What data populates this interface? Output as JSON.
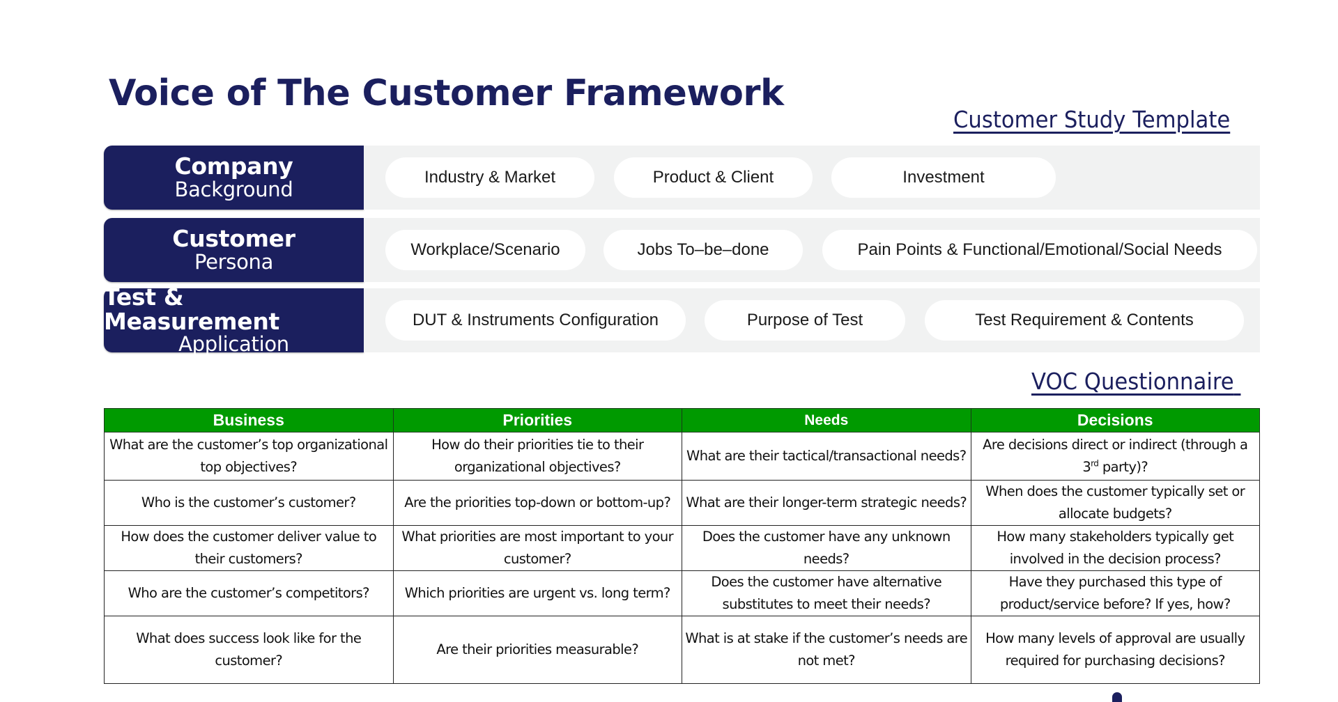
{
  "title": "Voice of The Customer Framework",
  "customer_study": {
    "heading": "Customer Study Template",
    "rows": [
      {
        "main": "Company",
        "sub": "Background",
        "pills": [
          "Industry & Market",
          "Product & Client",
          "Investment"
        ]
      },
      {
        "main": "Customer",
        "sub": "Persona",
        "pills": [
          "Workplace/Scenario",
          "Jobs To–be–done",
          "Pain Points & Functional/Emotional/Social Needs"
        ]
      },
      {
        "main": "Test & Measurement",
        "sub": "Application",
        "pills": [
          "DUT & Instruments Configuration",
          "Purpose of Test",
          "Test Requirement & Contents"
        ]
      }
    ]
  },
  "questionnaire": {
    "heading": "VOC Questionnaire",
    "columns": [
      "Business",
      "Priorities",
      "Needs",
      "Decisions"
    ],
    "rows": [
      {
        "business": "What are the customer’s top organizational top objectives?",
        "priorities": "How do their priorities tie to their organizational objectives?",
        "needs": "What are their tactical/transactional needs?",
        "decisions_pre": "Are decisions direct or indirect (through a 3",
        "decisions_sup": "rd",
        "decisions_post": " party)?"
      },
      {
        "business": "Who is the customer’s customer?",
        "priorities": "Are the priorities top-down or bottom-up?",
        "needs": "What are their longer-term strategic needs?",
        "decisions": "When does the customer typically set or allocate budgets?"
      },
      {
        "business": "How does the customer deliver value to their customers?",
        "priorities": "What priorities are most important to your customer?",
        "needs": "Does the customer have any unknown needs?",
        "decisions": "How many stakeholders typically get involved in the decision process?"
      },
      {
        "business": "Who are the customer’s competitors?",
        "priorities": "Which priorities are urgent vs. long term?",
        "needs": "Does the customer have alternative substitutes to meet their needs?",
        "decisions": "Have they purchased this type of product/service before? If yes, how?"
      },
      {
        "business": "What does success look like for the customer?",
        "priorities": "Are their priorities measurable?",
        "needs": "What is at stake if the customer’s needs are not met?",
        "decisions": "How many levels of approval are usually required for purchasing decisions?"
      }
    ]
  },
  "colors": {
    "navy": "#1b1f5e",
    "green_header": "#009a00",
    "band_gray": "#f1f2f2"
  }
}
